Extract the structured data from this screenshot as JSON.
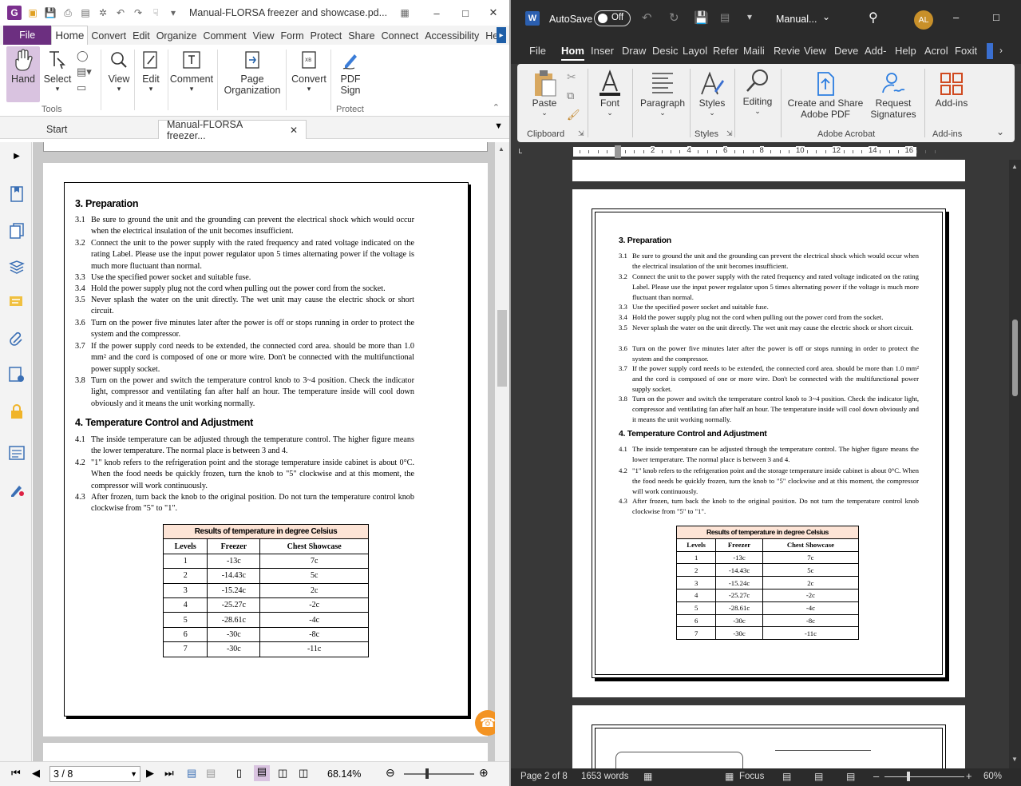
{
  "foxit": {
    "doc_title": "Manual-FLORSA freezer and showcase.pd...",
    "menu": {
      "file": "File",
      "items": [
        "Home",
        "Convert",
        "Edit",
        "Organize",
        "Comment",
        "View",
        "Form",
        "Protect",
        "Share",
        "Connect",
        "Accessibility",
        "Help"
      ]
    },
    "ribbon": {
      "hand": "Hand",
      "select": "Select",
      "view": "View",
      "edit": "Edit",
      "comment": "Comment",
      "page_org_1": "Page",
      "page_org_2": "Organization",
      "convert": "Convert",
      "pdf_sign_1": "PDF",
      "pdf_sign_2": "Sign",
      "grp_tools": "Tools",
      "grp_protect": "Protect"
    },
    "tabs": {
      "start": "Start",
      "doc": "Manual-FLORSA freezer..."
    },
    "page_nav": "3 / 8",
    "zoom": "68.14%"
  },
  "doc": {
    "sec3": "3. Preparation",
    "items3": [
      {
        "n": "3.1",
        "t": "Be sure to ground the unit and the grounding can prevent the electrical shock which would occur when the electrical insulation of the unit becomes insufficient."
      },
      {
        "n": "3.2",
        "t": "Connect the unit to the power supply with the rated frequency and rated voltage indicated on the rating Label. Please use the input power regulator upon 5 times alternating power if the voltage is much more fluctuant than normal."
      },
      {
        "n": "3.3",
        "t": "Use the specified power socket and suitable fuse."
      },
      {
        "n": "3.4",
        "t": "Hold the power supply plug not the cord when pulling out the power cord from the socket."
      },
      {
        "n": "3.5",
        "t": "Never splash the water on the unit directly. The wet unit may cause the electric shock or short circuit."
      },
      {
        "n": "3.6",
        "t": "Turn on the power five minutes later after the power is off or stops running in order to protect the system and the compressor."
      },
      {
        "n": "3.7",
        "t": "If the power supply cord needs to be extended, the connected cord area. should be more than 1.0 mm² and the cord is composed of one or more wire. Don't be connected with the multifunctional power supply socket."
      },
      {
        "n": "3.8",
        "t": "Turn on the power and switch the temperature control knob to 3~4 position. Check the indicator light, compressor and ventilating fan after half an hour. The temperature inside will cool down obviously and it means the unit working normally."
      }
    ],
    "sec4": "4. Temperature Control and Adjustment",
    "items4": [
      {
        "n": "4.1",
        "t": "The inside temperature can be adjusted through the temperature control. The higher figure means the lower temperature. The normal place is between 3 and 4."
      },
      {
        "n": "4.2",
        "t": "\"1\" knob refers to the refrigeration point and the storage temperature inside cabinet is about 0°C. When the food needs be quickly frozen, turn the knob to \"5\" clockwise and at this moment, the compressor will work continuously."
      },
      {
        "n": "4.3",
        "t": "After frozen, turn back the knob to the original position. Do not turn the temperature control knob clockwise from \"5\" to \"1\"."
      }
    ],
    "table": {
      "caption": "Results of temperature in degree Celsius",
      "headers": [
        "Levels",
        "Freezer",
        "Chest Showcase"
      ],
      "rows": [
        [
          "1",
          "-13c",
          "7c"
        ],
        [
          "2",
          "-14.43c",
          "5c"
        ],
        [
          "3",
          "-15.24c",
          "2c"
        ],
        [
          "4",
          "-25.27c",
          "-2c"
        ],
        [
          "5",
          "-28.61c",
          "-4c"
        ],
        [
          "6",
          "-30c",
          "-8c"
        ],
        [
          "7",
          "-30c",
          "-11c"
        ]
      ]
    }
  },
  "word": {
    "autosave": "AutoSave",
    "toggle": "Off",
    "doc_name": "Manual...",
    "avatar": "AL",
    "tabs": [
      "File",
      "Hom",
      "Inser",
      "Draw",
      "Desic",
      "Layol",
      "Refer",
      "Maili",
      "Revie",
      "View",
      "Deve",
      "Add-",
      "Help",
      "Acrol",
      "Foxit"
    ],
    "ribbon": {
      "paste": "Paste",
      "font": "Font",
      "paragraph": "Paragraph",
      "styles": "Styles",
      "editing": "Editing",
      "cs1": "Create and Share",
      "cs2": "Adobe PDF",
      "rs1": "Request",
      "rs2": "Signatures",
      "addins": "Add-ins",
      "grp_clipboard": "Clipboard",
      "grp_styles": "Styles",
      "grp_acrobat": "Adobe Acrobat",
      "grp_addins": "Add-ins"
    },
    "ruler": [
      "2",
      "4",
      "6",
      "8",
      "10",
      "12",
      "14",
      "16"
    ],
    "status": {
      "page": "Page 2 of 8",
      "words": "1653 words",
      "focus": "Focus",
      "zoom": "60%"
    }
  }
}
